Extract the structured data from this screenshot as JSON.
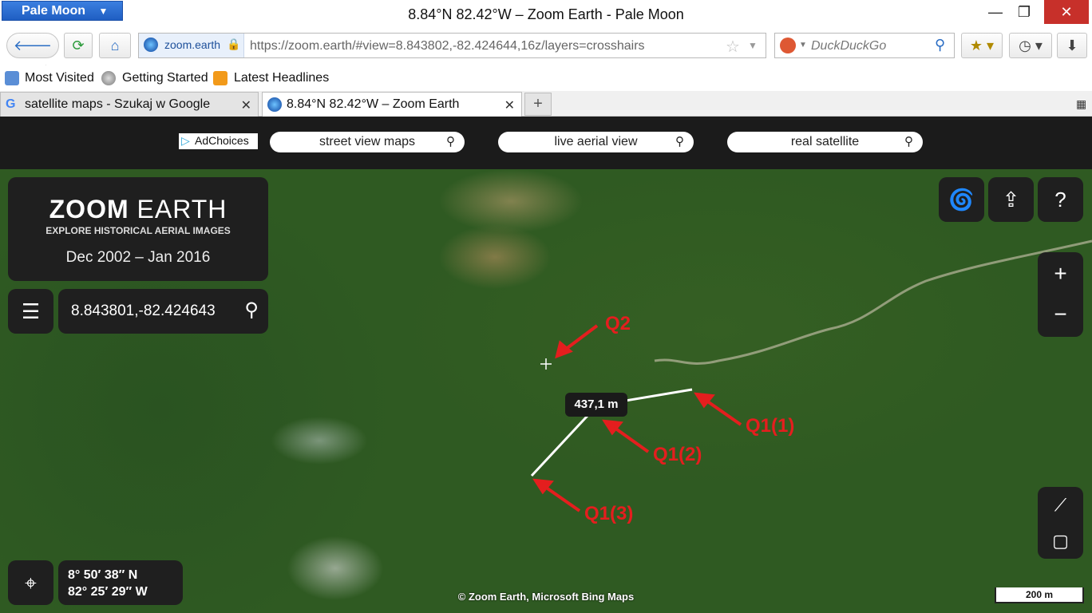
{
  "browser": {
    "app_menu": "Pale Moon",
    "window_title": "8.84°N 82.42°W – Zoom Earth - Pale Moon",
    "url_site": "zoom.earth",
    "url": "https://zoom.earth/#view=8.843802,-82.424644,16z/layers=crosshairs",
    "search_placeholder": "DuckDuckGo",
    "bookmarks": [
      "Most Visited",
      "Getting Started",
      "Latest Headlines"
    ],
    "tabs": [
      {
        "label": "satellite maps - Szukaj w Google",
        "active": false
      },
      {
        "label": "8.84°N 82.42°W – Zoom Earth",
        "active": true
      }
    ]
  },
  "ads": {
    "adchoices": "AdChoices",
    "pills": [
      "street view maps",
      "live aerial view",
      "real satellite"
    ]
  },
  "zoom_earth": {
    "logo_title_bold": "ZOOM",
    "logo_title_light": "EARTH",
    "logo_subtitle": "EXPLORE HISTORICAL AERIAL IMAGES",
    "date_range": "Dec 2002 – Jan 2016",
    "coord_search": "8.843801,-82.424643",
    "lat": "8° 50′ 38″ N",
    "lon": "82° 25′ 29″ W",
    "attribution": "© Zoom Earth, Microsoft Bing Maps",
    "scale": "200 m",
    "distance": "437,1 m"
  },
  "annotations": {
    "q2": "Q2",
    "q1_1": "Q1(1)",
    "q1_2": "Q1(2)",
    "q1_3": "Q1(3)"
  }
}
